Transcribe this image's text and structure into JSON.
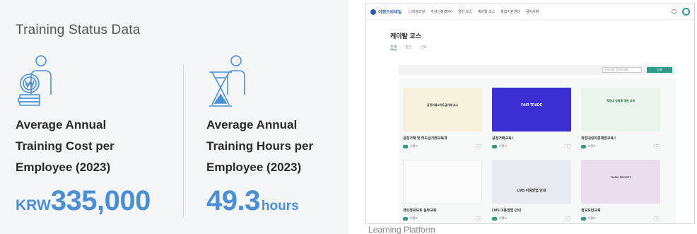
{
  "stats": {
    "title": "Training Status Data",
    "cost": {
      "label_lines": [
        "Average Annual",
        "Training Cost per",
        "Employee (2023)"
      ],
      "prefix": "KRW",
      "value": "335,000",
      "icon": "person-coin-icon"
    },
    "hours": {
      "label_lines": [
        "Average Annual",
        "Training Hours per",
        "Employee (2023)"
      ],
      "value": "49.3",
      "suffix": "hours",
      "icon": "person-hourglass-icon"
    },
    "accent_color": "#4a8fd6"
  },
  "screenshot": {
    "caption": "Learning Platform",
    "logo": "이랜드리테일",
    "nav": [
      "나의강의실",
      "수강신청(필수)",
      "일반 코스",
      "케이탈 코스",
      "학습지원센터",
      "공지사항"
    ],
    "page_title": "케이탈 코스",
    "tabs": [
      "전체",
      "필수",
      "선택"
    ],
    "search_placeholder": "검색어를 입력하세요",
    "search_button": "검색",
    "accent_color": "#2e9a8a",
    "cards": [
      {
        "title": "공정거래 및 하도급거래교육과",
        "author": "이랜드",
        "count": "1",
        "thumb": "th-yellow",
        "thumb_text": "공정거래&하도급거래 코스"
      },
      {
        "title": "공정거래교육 I",
        "author": "이랜드",
        "count": "2",
        "thumb": "th-blue",
        "thumb_text": "FAIR TRADE"
      },
      {
        "title": "직장내성희롱예방교육 I",
        "author": "이랜드",
        "count": "1",
        "thumb": "th-green",
        "thumb_text": "직장내 성희롱 예방 교육"
      },
      {
        "title": "개인정보보호 실무교육",
        "author": "이랜드",
        "count": "0",
        "thumb": "th-white",
        "thumb_text": ""
      },
      {
        "title": "LMS 이용방법 안내",
        "author": "이랜드",
        "count": "1",
        "thumb": "th-navy",
        "thumb_text": "LMS 이용방법 안내"
      },
      {
        "title": "정보보안교육",
        "author": "이랜드",
        "count": "2",
        "thumb": "th-purple",
        "thumb_text": "THINK SECRET"
      }
    ]
  }
}
